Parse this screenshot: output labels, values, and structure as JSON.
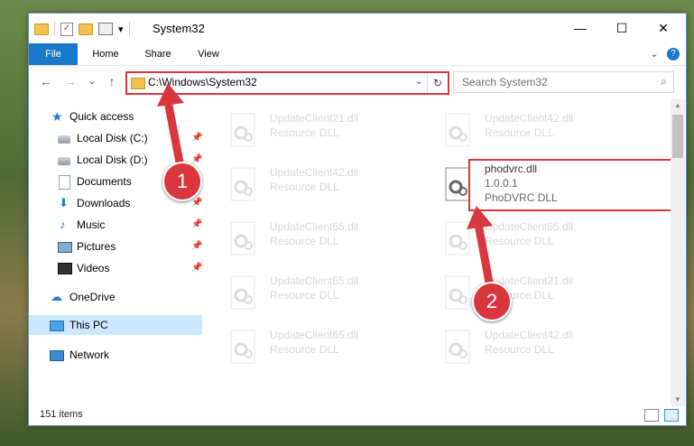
{
  "window": {
    "title": "System32",
    "controls": {
      "minimize": "—",
      "maximize": "☐",
      "close": "✕"
    }
  },
  "quick_access_toolbar": {
    "dropdown": "▾"
  },
  "ribbon": {
    "tabs": [
      {
        "label": "File"
      },
      {
        "label": "Home"
      },
      {
        "label": "Share"
      },
      {
        "label": "View"
      }
    ],
    "expand": "⌄",
    "help": "?"
  },
  "navigation": {
    "back": "←",
    "forward": "→",
    "recent": "⌄",
    "up": "↑",
    "address_path": "C:\\Windows\\System32",
    "address_dropdown": "⌄",
    "refresh": "↻",
    "search_placeholder": "Search System32",
    "search_icon": "⌕"
  },
  "sidebar": {
    "items": [
      {
        "label": "Quick access",
        "icon": "star-icon"
      },
      {
        "label": "Local Disk (C:)",
        "icon": "drive-icon",
        "pinned": true
      },
      {
        "label": "Local Disk (D:)",
        "icon": "drive-icon",
        "pinned": true
      },
      {
        "label": "Documents",
        "icon": "documents-icon",
        "pinned": true
      },
      {
        "label": "Downloads",
        "icon": "download-icon",
        "pinned": true
      },
      {
        "label": "Music",
        "icon": "music-icon",
        "pinned": true
      },
      {
        "label": "Pictures",
        "icon": "pictures-icon",
        "pinned": true
      },
      {
        "label": "Videos",
        "icon": "videos-icon",
        "pinned": true
      },
      {
        "label": "OneDrive",
        "icon": "cloud-icon"
      },
      {
        "label": "This PC",
        "icon": "computer-icon",
        "selected": true
      },
      {
        "label": "Network",
        "icon": "network-icon"
      }
    ],
    "pin_glyph": "📌"
  },
  "files": [
    {
      "name": "UpdateClient21.dll",
      "desc": "Resource DLL"
    },
    {
      "name": "UpdateClient42.dll",
      "desc": "Resource DLL"
    },
    {
      "name": "UpdateClient42.dll",
      "desc": "Resource DLL"
    },
    {
      "name": "phodvrc.dll",
      "version": "1.0.0.1",
      "desc": "PhoDVRC DLL",
      "highlighted": true
    },
    {
      "name": "UpdateClient65.dll",
      "desc": "Resource DLL"
    },
    {
      "name": "UpdateClient65.dll",
      "desc": "Resource DLL"
    },
    {
      "name": "UpdateClient65.dll",
      "desc": "Resource DLL"
    },
    {
      "name": "UpdateClient21.dll",
      "desc": "Resource DLL"
    },
    {
      "name": "UpdateClient65.dll",
      "desc": "Resource DLL"
    },
    {
      "name": "UpdateClient42.dll",
      "desc": "Resource DLL"
    }
  ],
  "status": {
    "item_count": "151 items"
  },
  "callouts": {
    "one": "1",
    "two": "2"
  },
  "colors": {
    "accent": "#1979ca",
    "callout_red": "#d9363e",
    "selected_bg": "#cce8ff"
  }
}
